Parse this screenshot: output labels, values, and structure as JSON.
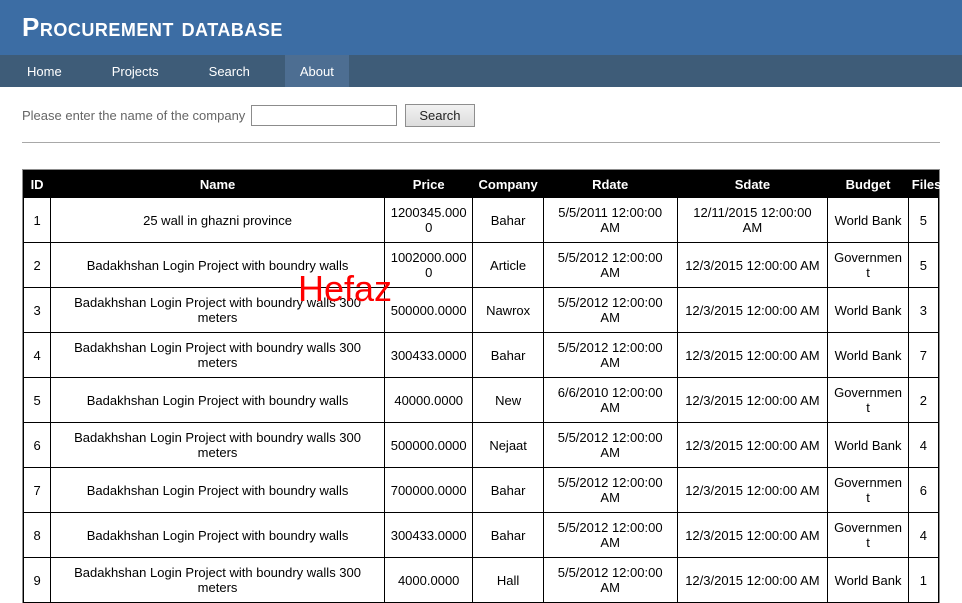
{
  "header": {
    "title": "Procurement database"
  },
  "nav": {
    "items": [
      {
        "label": "Home"
      },
      {
        "label": "Projects"
      },
      {
        "label": "Search"
      },
      {
        "label": "About",
        "active": true
      }
    ]
  },
  "search": {
    "label": "Please enter the name of the company",
    "value": "",
    "button": "Search"
  },
  "watermark": {
    "text": "Hefaz",
    "color": "#ff0000"
  },
  "table": {
    "columns": [
      "ID",
      "Name",
      "Price",
      "Company",
      "Rdate",
      "Sdate",
      "Budget",
      "Files"
    ],
    "rows": [
      [
        "1",
        "25 wall in ghazni province",
        "1200345.0000",
        "Bahar",
        "5/5/2011 12:00:00 AM",
        "12/11/2015 12:00:00 AM",
        "World Bank",
        "5"
      ],
      [
        "2",
        "Badakhshan Login Project with boundry walls",
        "1002000.0000",
        "Article",
        "5/5/2012 12:00:00 AM",
        "12/3/2015 12:00:00 AM",
        "Government",
        "5"
      ],
      [
        "3",
        "Badakhshan Login Project with boundry walls 300 meters",
        "500000.0000",
        "Nawrox",
        "5/5/2012 12:00:00 AM",
        "12/3/2015 12:00:00 AM",
        "World Bank",
        "3"
      ],
      [
        "4",
        "Badakhshan Login Project with boundry walls 300 meters",
        "300433.0000",
        "Bahar",
        "5/5/2012 12:00:00 AM",
        "12/3/2015 12:00:00 AM",
        "World Bank",
        "7"
      ],
      [
        "5",
        "Badakhshan Login Project with boundry walls",
        "40000.0000",
        "New",
        "6/6/2010 12:00:00 AM",
        "12/3/2015 12:00:00 AM",
        "Government",
        "2"
      ],
      [
        "6",
        "Badakhshan Login Project with boundry walls 300 meters",
        "500000.0000",
        "Nejaat",
        "5/5/2012 12:00:00 AM",
        "12/3/2015 12:00:00 AM",
        "World Bank",
        "4"
      ],
      [
        "7",
        "Badakhshan Login Project with boundry walls",
        "700000.0000",
        "Bahar",
        "5/5/2012 12:00:00 AM",
        "12/3/2015 12:00:00 AM",
        "Government",
        "6"
      ],
      [
        "8",
        "Badakhshan Login Project with boundry walls",
        "300433.0000",
        "Bahar",
        "5/5/2012 12:00:00 AM",
        "12/3/2015 12:00:00 AM",
        "Government",
        "4"
      ],
      [
        "9",
        "Badakhshan Login Project with boundry walls 300 meters",
        "4000.0000",
        "Hall",
        "5/5/2012 12:00:00 AM",
        "12/3/2015 12:00:00 AM",
        "World Bank",
        "1"
      ]
    ]
  }
}
